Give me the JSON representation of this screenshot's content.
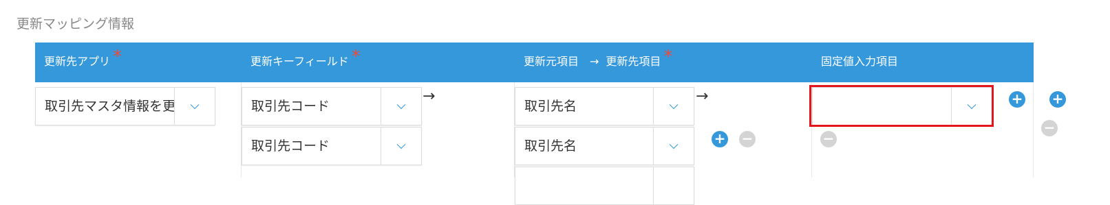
{
  "section": {
    "title": "更新マッピング情報"
  },
  "header": {
    "col_app": "更新先アプリ",
    "col_key": "更新キーフィールド",
    "col_src": "更新元項目",
    "col_arrow": "→",
    "col_dst": "更新先項目",
    "col_fixed": "固定値入力項目",
    "required_mark": "*"
  },
  "row": {
    "app_select": "取引先マスタ情報を更",
    "key_fields": [
      "取引先コード",
      "取引先コード"
    ],
    "arrow": "→",
    "source_fields": [
      "取引先名",
      "取引先名"
    ],
    "fixed_value": ""
  },
  "buttons": {
    "plus": "+",
    "minus": "−"
  },
  "colors": {
    "header_bg": "#3498db",
    "required": "#e74c3c",
    "highlight": "#e3161e"
  }
}
